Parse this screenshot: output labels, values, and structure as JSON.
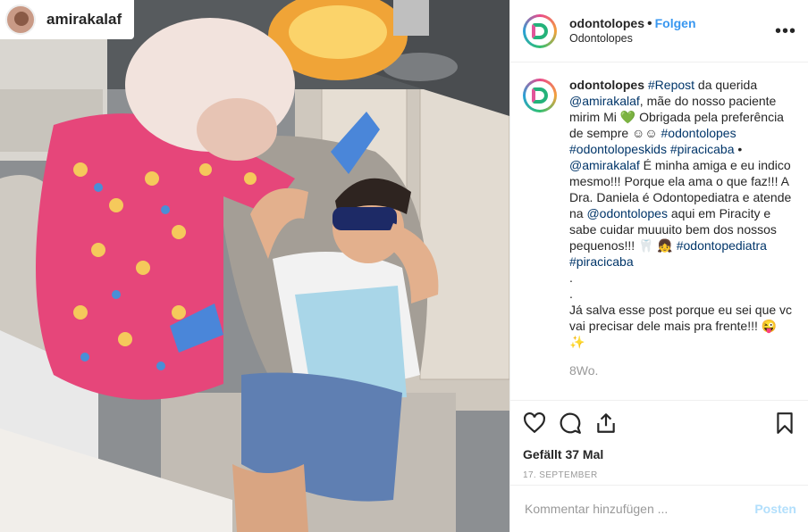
{
  "photo": {
    "tagged_user": "amirakalaf"
  },
  "header": {
    "username": "odontolopes",
    "separator": "•",
    "follow_label": "Folgen",
    "location": "Odontolopes",
    "more_icon": "ellipsis-icon"
  },
  "caption": {
    "author": "odontolopes",
    "lines": [
      {
        "parts": [
          {
            "t": "odontolopes",
            "k": "b"
          },
          {
            "t": " "
          },
          {
            "t": "#Repost",
            "k": "lk"
          },
          {
            "t": " da querida"
          }
        ]
      },
      {
        "parts": [
          {
            "t": "@amirakalaf",
            "k": "lk"
          },
          {
            "t": ", mãe do nosso paciente"
          }
        ]
      },
      {
        "parts": [
          {
            "t": "mirim Mi 💚  Obrigada pela preferência"
          }
        ]
      },
      {
        "parts": [
          {
            "t": "de sempre ☺☺ "
          },
          {
            "t": "#odontolopes",
            "k": "lk"
          }
        ]
      },
      {
        "parts": [
          {
            "t": "#odontolopeskids",
            "k": "lk"
          },
          {
            "t": " "
          },
          {
            "t": "#piracicaba",
            "k": "lk"
          },
          {
            "t": " •"
          }
        ]
      },
      {
        "parts": [
          {
            "t": "@amirakalaf",
            "k": "lk"
          },
          {
            "t": " É minha amiga e eu indico"
          }
        ]
      },
      {
        "parts": [
          {
            "t": "mesmo!!! Porque ela ama o que faz!!! A"
          }
        ]
      },
      {
        "parts": [
          {
            "t": "Dra. Daniela é Odontopediatra e atende"
          }
        ]
      },
      {
        "parts": [
          {
            "t": "na "
          },
          {
            "t": "@odontolopes",
            "k": "lk"
          },
          {
            "t": " aqui em Piracity e"
          }
        ]
      },
      {
        "parts": [
          {
            "t": "sabe cuidar muuuito bem dos nossos"
          }
        ]
      },
      {
        "parts": [
          {
            "t": "pequenos!!! 🦷 👧  "
          },
          {
            "t": "#odontopediatra",
            "k": "lk"
          }
        ]
      },
      {
        "parts": [
          {
            "t": "#piracicaba",
            "k": "lk"
          }
        ]
      },
      {
        "parts": [
          {
            "t": "."
          }
        ]
      },
      {
        "parts": [
          {
            "t": "."
          }
        ]
      },
      {
        "parts": [
          {
            "t": "Já salva esse post porque eu sei que vc"
          }
        ]
      },
      {
        "parts": [
          {
            "t": "vai precisar dele mais pra frente!!! 😜"
          }
        ]
      },
      {
        "parts": [
          {
            "t": "✨"
          }
        ]
      }
    ],
    "timestamp": "8Wo."
  },
  "actions": {
    "like_icon": "heart-icon",
    "comment_icon": "comment-icon",
    "share_icon": "share-icon",
    "save_icon": "bookmark-icon",
    "likes_text": "Gefällt 37 Mal",
    "date": "17. SEPTEMBER"
  },
  "comment": {
    "placeholder": "Kommentar hinzufügen ...",
    "post_label": "Posten"
  },
  "colors": {
    "link": "#003569",
    "follow": "#3897f0",
    "post_disabled": "#b2dffc",
    "muted": "#999999",
    "border": "#efefef"
  }
}
